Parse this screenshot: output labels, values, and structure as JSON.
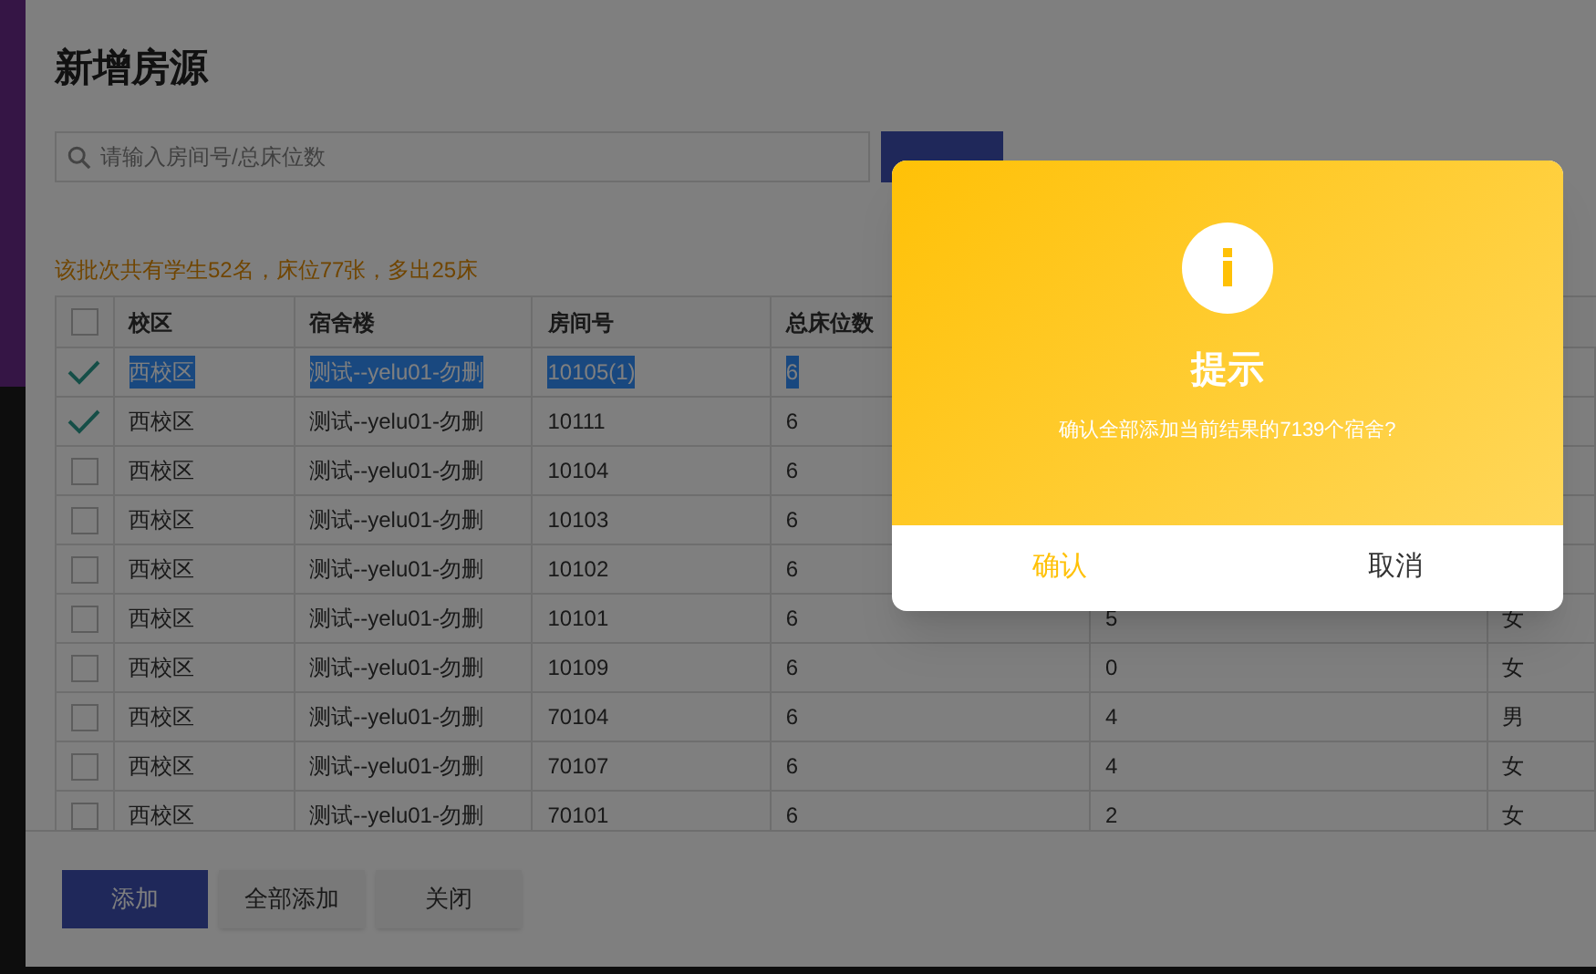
{
  "page": {
    "title": "新增房源"
  },
  "search": {
    "placeholder": "请输入房间号/总床位数"
  },
  "summary": "该批次共有学生52名，床位77张，多出25床",
  "table": {
    "header_checkbox": {
      "checked": false
    },
    "columns": [
      "校区",
      "宿舍楼",
      "房间号",
      "总床位数"
    ],
    "rows": [
      {
        "checked": true,
        "highlighted": true,
        "cells": [
          "西校区",
          "测试--yelu01-勿删",
          "10105(1)",
          "6"
        ]
      },
      {
        "checked": true,
        "highlighted": false,
        "cells": [
          "西校区",
          "测试--yelu01-勿删",
          "10111",
          "6"
        ]
      },
      {
        "checked": false,
        "highlighted": false,
        "cells": [
          "西校区",
          "测试--yelu01-勿删",
          "10104",
          "6"
        ]
      },
      {
        "checked": false,
        "highlighted": false,
        "cells": [
          "西校区",
          "测试--yelu01-勿删",
          "10103",
          "6"
        ]
      },
      {
        "checked": false,
        "highlighted": false,
        "cells": [
          "西校区",
          "测试--yelu01-勿删",
          "10102",
          "6"
        ]
      },
      {
        "checked": false,
        "highlighted": false,
        "cells": [
          "西校区",
          "测试--yelu01-勿删",
          "10101",
          "6",
          "5",
          "女"
        ]
      },
      {
        "checked": false,
        "highlighted": false,
        "cells": [
          "西校区",
          "测试--yelu01-勿删",
          "10109",
          "6",
          "0",
          "女"
        ]
      },
      {
        "checked": false,
        "highlighted": false,
        "cells": [
          "西校区",
          "测试--yelu01-勿删",
          "70104",
          "6",
          "4",
          "男"
        ]
      },
      {
        "checked": false,
        "highlighted": false,
        "cells": [
          "西校区",
          "测试--yelu01-勿删",
          "70107",
          "6",
          "4",
          "女"
        ]
      },
      {
        "checked": false,
        "highlighted": false,
        "cells": [
          "西校区",
          "测试--yelu01-勿删",
          "70101",
          "6",
          "2",
          "女"
        ]
      }
    ]
  },
  "footer_buttons": [
    {
      "label": "添加",
      "kind": "primary"
    },
    {
      "label": "全部添加",
      "kind": "default"
    },
    {
      "label": "关闭",
      "kind": "default"
    }
  ],
  "dialog": {
    "title": "提示",
    "message": "确认全部添加当前结果的7139个宿舍?",
    "confirm": "确认",
    "cancel": "取消"
  }
}
